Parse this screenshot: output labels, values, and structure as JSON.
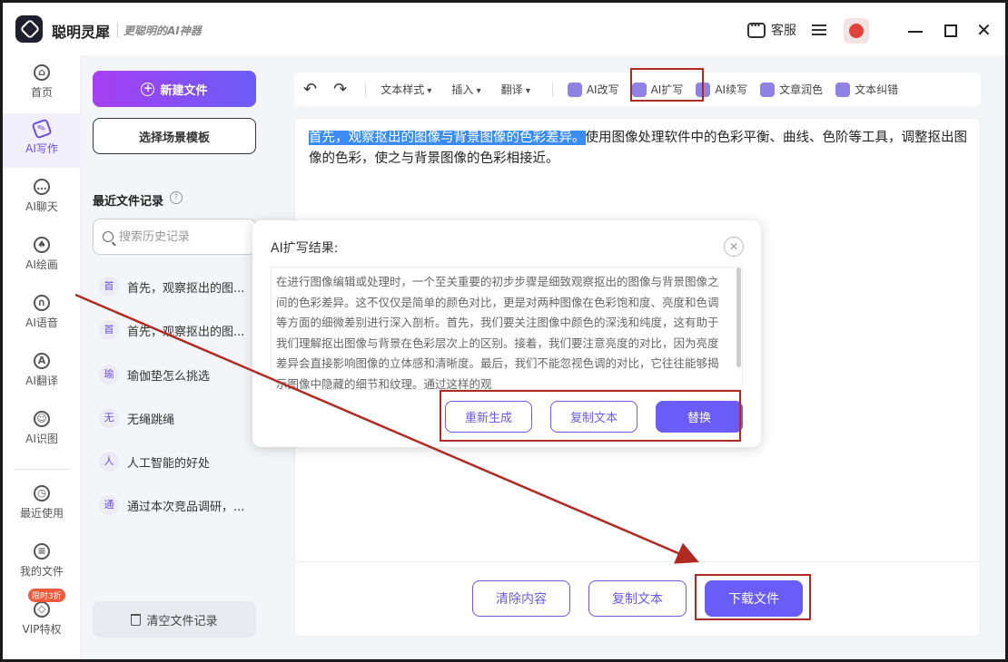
{
  "app": {
    "name": "聪明灵犀",
    "slogan": "更聪明的AI神器",
    "service_label": "客服"
  },
  "leftnav": {
    "items": [
      {
        "label": "首页",
        "icon": "home-icon"
      },
      {
        "label": "AI写作",
        "icon": "pen-icon"
      },
      {
        "label": "AI聊天",
        "icon": "chat-icon"
      },
      {
        "label": "AI绘画",
        "icon": "brush-icon"
      },
      {
        "label": "AI语音",
        "icon": "headphone-icon"
      },
      {
        "label": "AI翻译",
        "icon": "translate-icon"
      },
      {
        "label": "AI识图",
        "icon": "scan-icon"
      },
      {
        "label": "最近使用",
        "icon": "clock-icon"
      },
      {
        "label": "我的文件",
        "icon": "file-icon"
      },
      {
        "label": "VIP特权",
        "icon": "diamond-icon"
      }
    ],
    "vip_badge": "限时3折"
  },
  "panel": {
    "new_file_label": "新建文件",
    "template_label": "选择场景模板",
    "recent_title": "最近文件记录",
    "search_placeholder": "搜索历史记录",
    "recent_items": [
      {
        "badge": "首",
        "text": "首先，观察抠出的图..."
      },
      {
        "badge": "首",
        "text": "首先，观察抠出的图..."
      },
      {
        "badge": "瑜",
        "text": "瑜伽垫怎么挑选"
      },
      {
        "badge": "无",
        "text": "无绳跳绳"
      },
      {
        "badge": "人",
        "text": "人工智能的好处"
      },
      {
        "badge": "通",
        "text": "通过本次竞品调研，..."
      }
    ],
    "clear_label": "清空文件记录"
  },
  "toolbar": {
    "undo": "↶",
    "redo": "↷",
    "text_style": "文本样式",
    "insert": "插入",
    "translate": "翻译",
    "ai_rewrite": "AI改写",
    "ai_expand": "AI扩写",
    "ai_continue": "AI续写",
    "polish": "文章润色",
    "correct": "文本纠错"
  },
  "editor": {
    "highlighted": "首先，观察抠出的图像与背景图像的色彩差异。",
    "rest": "使用图像处理软件中的色彩平衡、曲线、色阶等工具，调整抠出图像的色彩，使之与背景图像的色彩相接近。",
    "clear_label": "清除内容",
    "copy_label": "复制文本",
    "download_label": "下载文件"
  },
  "popup": {
    "title": "AI扩写结果:",
    "body": "在进行图像编辑或处理时，一个至关重要的初步步骤是细致观察抠出的图像与背景图像之间的色彩差异。这不仅仅是简单的颜色对比，更是对两种图像在色彩饱和度、亮度和色调等方面的细微差别进行深入剖析。首先，我们要关注图像中颜色的深浅和纯度，这有助于我们理解抠出图像与背景在色彩层次上的区别。接着，我们要注意亮度的对比，因为亮度差异会直接影响图像的立体感和清晰度。最后，我们不能忽视色调的对比，它往往能够揭示图像中隐藏的细节和纹理。通过这样的观",
    "regenerate_label": "重新生成",
    "copy_label": "复制文本",
    "replace_label": "替换"
  },
  "colors": {
    "accent": "#6a5cf6",
    "annotation": "#b02a22",
    "highlight": "#3b8cf5"
  }
}
